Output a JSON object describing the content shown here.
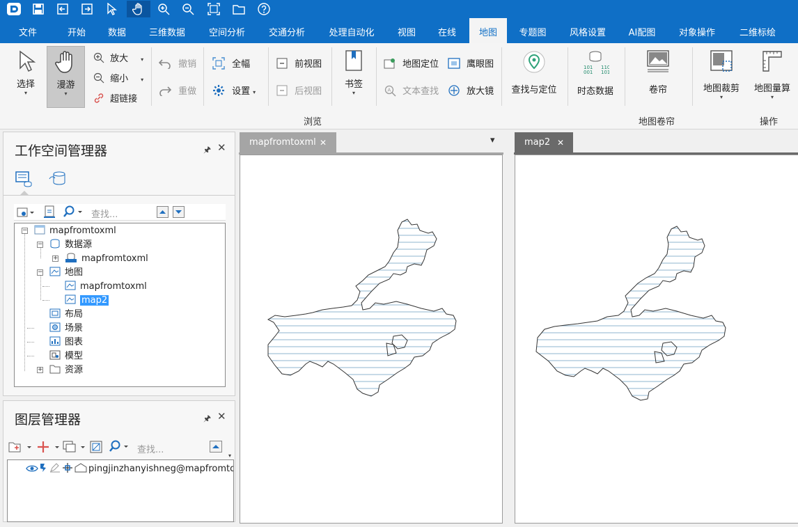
{
  "quick_access": {
    "icons": [
      "app-logo-icon",
      "save-icon",
      "import-icon",
      "export-icon",
      "pointer-icon",
      "pan-hand-icon",
      "zoom-in-icon",
      "zoom-out-icon",
      "full-extent-icon",
      "folder-icon",
      "help-icon"
    ]
  },
  "menu": {
    "tabs": [
      "文件",
      "开始",
      "数据",
      "三维数据",
      "空间分析",
      "交通分析",
      "处理自动化",
      "视图",
      "在线",
      "地图",
      "专题图",
      "风格设置",
      "AI配图",
      "对象操作",
      "二维标绘"
    ],
    "active": "地图"
  },
  "ribbon": {
    "select": "选择",
    "pan": "漫游",
    "zoom_in": "放大",
    "zoom_out": "缩小",
    "hyperlink": "超链接",
    "undo": "撤销",
    "redo": "重做",
    "full_extent": "全幅",
    "settings": "设置",
    "prev_view": "前视图",
    "next_view": "后视图",
    "bookmark": "书签",
    "map_locate": "地图定位",
    "text_find": "文本查找",
    "eagle_eye": "鹰眼图",
    "magnifier": "放大镜",
    "find_locate": "查找与定位",
    "temporal_data": "时态数据",
    "swipe": "卷帘",
    "map_clip": "地图裁剪",
    "map_measure": "地图量算",
    "group_browse": "浏览",
    "group_swipe": "地图卷帘",
    "group_ops": "操作"
  },
  "workspace": {
    "title": "工作空间管理器",
    "search_placeholder": "查找...",
    "tree": {
      "root": "mapfromtoxml",
      "datasources": "数据源",
      "datasource_item": "mapfromtoxml",
      "maps": "地图",
      "map1": "mapfromtoxml",
      "map2": "map2",
      "layouts": "布局",
      "scenes": "场景",
      "charts": "图表",
      "models": "模型",
      "resources": "资源"
    }
  },
  "layers": {
    "title": "图层管理器",
    "search_placeholder": "查找...",
    "layer_name": "pingjinzhanyishneg@mapfromtoxml"
  },
  "documents": {
    "tab1": "mapfromtoxml",
    "tab2": "map2",
    "close_glyph": "✕",
    "dropdown_glyph": "▾"
  },
  "colors": {
    "accent": "#0f6fc6",
    "active_doc_tab": "#6a6a6a",
    "inactive_doc_tab": "#a5a5a5",
    "selection": "#3399ff",
    "hatch_line": "#8fb4cf"
  }
}
